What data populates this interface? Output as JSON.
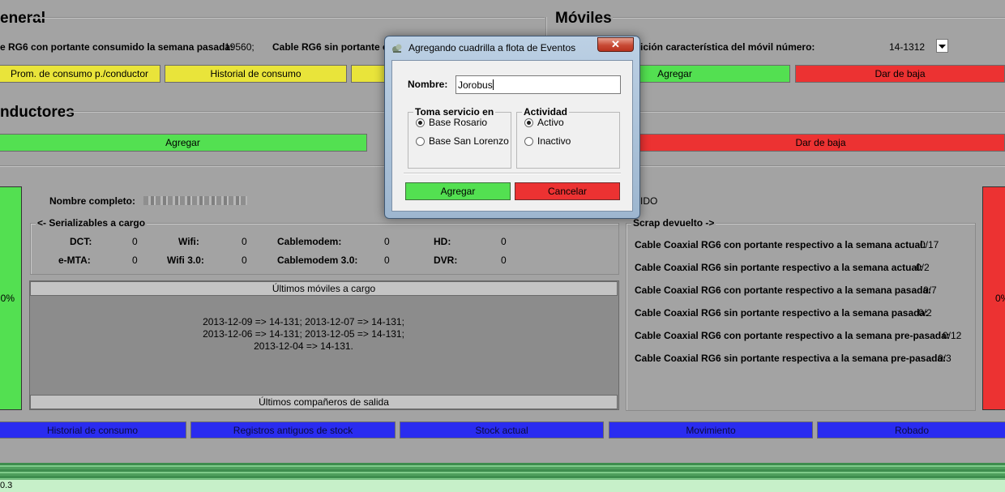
{
  "general": {
    "title": "eneral",
    "cable_con_label": "e RG6 con portante consumido la semana pasada:",
    "cable_con_value": "19560;",
    "cable_sin_label": "Cable RG6 sin portante co",
    "buttons": [
      "Prom. de consumo p./conductor",
      "Historial de consumo"
    ]
  },
  "moviles": {
    "title": "Móviles",
    "select_label": "ición característica del móvil número:",
    "select_value": "14-1312",
    "add_label": "Agregar",
    "remove_label": "Dar de baja"
  },
  "conductores": {
    "title": "nductores",
    "add_label": "Agregar",
    "remove_label": "Dar de baja"
  },
  "left_gauge": {
    "text": "0%",
    "color": "#53e051"
  },
  "right_gauge": {
    "text": "0%",
    "color": "#ec3232"
  },
  "detail": {
    "name_label": "Nombre completo:",
    "status_fragment": "IDO",
    "serializables": {
      "title": "<- Serializables a cargo",
      "rows": [
        [
          {
            "label": "DCT:",
            "value": "0"
          },
          {
            "label": "Wifi:",
            "value": "0"
          },
          {
            "label": "Cablemodem:",
            "value": "0"
          },
          {
            "label": "HD:",
            "value": "0"
          }
        ],
        [
          {
            "label": "e-MTA:",
            "value": "0"
          },
          {
            "label": "Wifi 3.0:",
            "value": "0"
          },
          {
            "label": "Cablemodem 3.0:",
            "value": "0"
          },
          {
            "label": "DVR:",
            "value": "0"
          }
        ]
      ]
    },
    "ultimos_moviles": {
      "header": "Últimos móviles a cargo",
      "lines": [
        "2013-12-09 => 14-131; 2013-12-07 => 14-131;",
        "2013-12-06 => 14-131; 2013-12-05 => 14-131;",
        "2013-12-04 => 14-131."
      ]
    },
    "ultimos_companeros": {
      "header": "Últimos compañeros de salida"
    },
    "scrap": {
      "title": "Scrap devuelto ->",
      "rows": [
        {
          "label": "Cable Coaxial RG6 con portante respectivo a la semana actual:",
          "value": "0/17"
        },
        {
          "label": "Cable Coaxial RG6 sin portante respectivo a la semana actual:",
          "value": "0/2"
        },
        {
          "label": "Cable Coaxial RG6 con portante respectivo a la semana pasada:",
          "value": "0/7"
        },
        {
          "label": "Cable Coaxial RG6 sin portante respectivo a la semana pasada:",
          "value": "0/2"
        },
        {
          "label": "Cable Coaxial RG6 con portante respectivo a la semana pre-pasada:",
          "value": "0/12"
        },
        {
          "label": "Cable Coaxial RG6 sin portante respectiva a la semana pre-pasada:",
          "value": "0/3"
        }
      ]
    }
  },
  "bottom_tabs": [
    "Historial de consumo",
    "Registros antiguos de stock",
    "Stock actual",
    "Movimiento",
    "Robado"
  ],
  "status_bar": {
    "text": "0.3"
  },
  "dialog": {
    "title": "Agregando cuadrilla a flota de Eventos",
    "close_glyph": "✕",
    "name_label": "Nombre:",
    "name_value": "Jorobus",
    "toma_servicio": {
      "title": "Toma servicio en",
      "options": [
        "Base Rosario",
        "Base San Lorenzo"
      ],
      "selected": "Base Rosario"
    },
    "actividad": {
      "title": "Actividad",
      "options": [
        "Activo",
        "Inactivo"
      ],
      "selected": "Activo"
    },
    "ok_label": "Agregar",
    "cancel_label": "Cancelar"
  }
}
